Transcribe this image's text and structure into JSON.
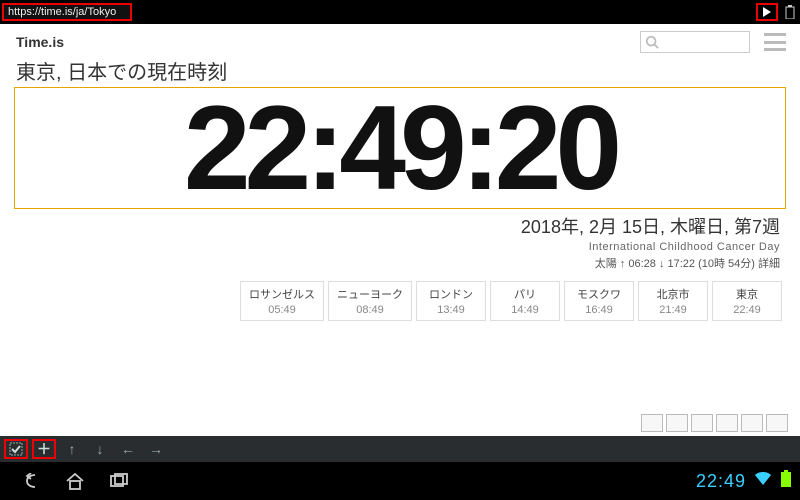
{
  "browser": {
    "url": "https://time.is/ja/Tokyo"
  },
  "site": {
    "name": "Time.is"
  },
  "heading": "東京, 日本での現在時刻",
  "clock": "22:49:20",
  "date_line": "2018年, 2月 15日, 木曜日, 第7週",
  "event_line": "International Childhood Cancer Day",
  "sun_line": "太陽 ↑ 06:28 ↓ 17:22 (10時 54分) 詳細",
  "cities": [
    {
      "name": "ロサンゼルス",
      "time": "05:49"
    },
    {
      "name": "ニューヨーク",
      "time": "08:49"
    },
    {
      "name": "ロンドン",
      "time": "13:49"
    },
    {
      "name": "パリ",
      "time": "14:49"
    },
    {
      "name": "モスクワ",
      "time": "16:49"
    },
    {
      "name": "北京市",
      "time": "21:49"
    },
    {
      "name": "東京",
      "time": "22:49"
    }
  ],
  "status": {
    "clock": "22:49"
  }
}
